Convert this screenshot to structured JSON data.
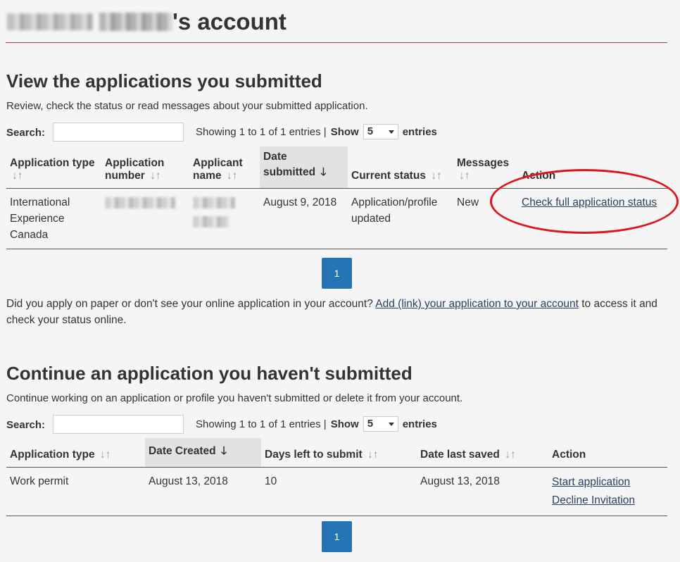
{
  "header": {
    "title_suffix": "'s account"
  },
  "submitted": {
    "heading": "View the applications you submitted",
    "description": "Review, check the status or read messages about your submitted application.",
    "search_label": "Search:",
    "showing_text": "Showing 1 to 1 of 1 entries |",
    "show_label": "Show",
    "page_size": "5",
    "entries_label": "entries",
    "columns": {
      "application_type": "Application type",
      "application_number_1": "Application",
      "application_number_2": "number",
      "applicant_name_1": "Applicant",
      "applicant_name_2": "name",
      "date_submitted_1": "Date",
      "date_submitted_2": "submitted",
      "current_status": "Current status",
      "messages": "Messages",
      "action": "Action"
    },
    "row": {
      "type_1": "International",
      "type_2": "Experience",
      "type_3": "Canada",
      "date_submitted": "August 9, 2018",
      "status_1": "Application/profile",
      "status_2": "updated",
      "messages": "New",
      "action_link": "Check full application status"
    },
    "page": "1"
  },
  "note": {
    "before": "Did you apply on paper or don't see your online application in your account? ",
    "link": "Add (link) your application to your account",
    "after": " to access it and check your status online."
  },
  "unsubmitted": {
    "heading": "Continue an application you haven't submitted",
    "description": "Continue working on an application or profile you haven't submitted or delete it from your account.",
    "search_label": "Search:",
    "showing_text": "Showing 1 to 1 of 1 entries |",
    "show_label": "Show",
    "page_size": "5",
    "entries_label": "entries",
    "columns": {
      "application_type": "Application type",
      "date_created": "Date Created",
      "days_left": "Days left to submit",
      "date_last_saved": "Date last saved",
      "action": "Action"
    },
    "row": {
      "type": "Work permit",
      "date_created": "August 13, 2018",
      "days_left": "10",
      "date_last_saved": "August 13, 2018",
      "start_link": "Start application",
      "decline_link": "Decline Invitation"
    },
    "page": "1"
  },
  "icons": {
    "sort": "sort-arrows-icon",
    "sort_desc": "sort-down-arrow-icon",
    "dropdown": "caret-down-icon"
  },
  "colors": {
    "link": "#284162",
    "pager": "#2572b4",
    "title_rule": "#af3c43",
    "annotation": "#e0141e"
  }
}
